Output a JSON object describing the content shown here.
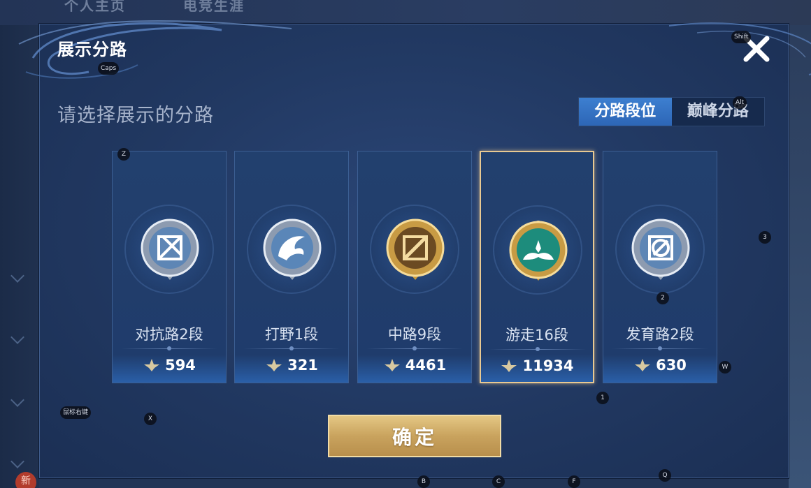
{
  "background": {
    "tabs": [
      "个人主页",
      "电竞生涯"
    ],
    "new_badge": "新"
  },
  "dialog": {
    "title": "展示分路",
    "subtitle": "请选择展示的分路",
    "toggle": {
      "options": [
        "分路段位",
        "巅峰分路"
      ],
      "active_index": 0
    },
    "cards": [
      {
        "rank": "对抗路2段",
        "score": "594",
        "icon": "clash-lane-badge-icon",
        "tier": "silver"
      },
      {
        "rank": "打野1段",
        "score": "321",
        "icon": "jungle-badge-icon",
        "tier": "silver"
      },
      {
        "rank": "中路9段",
        "score": "4461",
        "icon": "mid-lane-badge-icon",
        "tier": "gold"
      },
      {
        "rank": "游走16段",
        "score": "11934",
        "icon": "roam-badge-icon",
        "tier": "emerald",
        "selected": true
      },
      {
        "rank": "发育路2段",
        "score": "630",
        "icon": "farm-lane-badge-icon",
        "tier": "silver"
      }
    ],
    "confirm_label": "确定"
  },
  "key_hints": {
    "caps": "Caps",
    "shift": "Shift",
    "alt": "Alt",
    "z": "Z",
    "three": "3",
    "two": "2",
    "w": "W",
    "one": "1",
    "x": "X",
    "mouse_right": "鼠标右键",
    "b": "B",
    "c": "C",
    "f": "F",
    "q": "Q"
  },
  "colors": {
    "accent_blue": "#2f6cbf",
    "gold": "#d6b36d",
    "selected_border": "#e8c992"
  }
}
